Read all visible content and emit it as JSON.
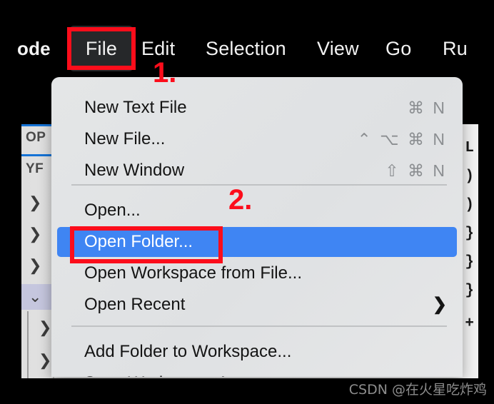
{
  "app": {
    "window_bg": "#000000",
    "accent_highlight": "#3f85f3",
    "annotation_color": "#fc0d1b"
  },
  "menubar": {
    "app_name": "ode",
    "items": [
      {
        "label": "File",
        "active": true,
        "highlight_bg": "#26282a"
      },
      {
        "label": "Edit",
        "active": false
      },
      {
        "label": "Selection",
        "active": false
      },
      {
        "label": "View",
        "active": false
      },
      {
        "label": "Go",
        "active": false
      },
      {
        "label": "Ru",
        "active": false
      }
    ]
  },
  "annotations": {
    "step_one": "1.",
    "step_two": "2."
  },
  "sidebar": {
    "section_open_editors": "OP",
    "section_folder": "YF",
    "tree_rows": [
      {
        "chevron": "❯",
        "selected": false
      },
      {
        "chevron": "❯",
        "selected": false
      },
      {
        "chevron": "❯",
        "selected": false
      },
      {
        "chevron": "⌄",
        "selected": true
      },
      {
        "chevron": "❯",
        "selected": false,
        "child": true
      },
      {
        "chevron": "❯",
        "selected": false,
        "child": true
      }
    ]
  },
  "editor_fragments": [
    {
      "text": "L"
    },
    {
      "text": ")"
    },
    {
      "text": ")"
    },
    {
      "text": "}"
    },
    {
      "text": "}"
    },
    {
      "text": "}"
    },
    {
      "text": "+"
    }
  ],
  "dropdown": {
    "menu_name": "File",
    "groups": [
      {
        "items": [
          {
            "label": "New Text File",
            "shortcut": "⌘ N",
            "highlighted": false,
            "submenu": false
          },
          {
            "label": "New File...",
            "shortcut": "⌃ ⌥ ⌘ N",
            "highlighted": false,
            "submenu": false
          },
          {
            "label": "New Window",
            "shortcut": "⇧ ⌘ N",
            "highlighted": false,
            "submenu": false
          }
        ]
      },
      {
        "items": [
          {
            "label": "Open...",
            "shortcut": "",
            "highlighted": false,
            "submenu": false
          },
          {
            "label": "Open Folder...",
            "shortcut": "",
            "highlighted": true,
            "submenu": false
          },
          {
            "label": "Open Workspace from File...",
            "shortcut": "",
            "highlighted": false,
            "submenu": false
          },
          {
            "label": "Open Recent",
            "shortcut": "",
            "highlighted": false,
            "submenu": true,
            "submenu_glyph": "❯"
          }
        ]
      },
      {
        "items": [
          {
            "label": "Add Folder to Workspace...",
            "shortcut": "",
            "highlighted": false,
            "submenu": false
          },
          {
            "label": "Save Workspace As...",
            "shortcut": "",
            "highlighted": false,
            "submenu": false
          }
        ]
      }
    ]
  },
  "watermark": {
    "text": "CSDN @在火星吃炸鸡"
  }
}
